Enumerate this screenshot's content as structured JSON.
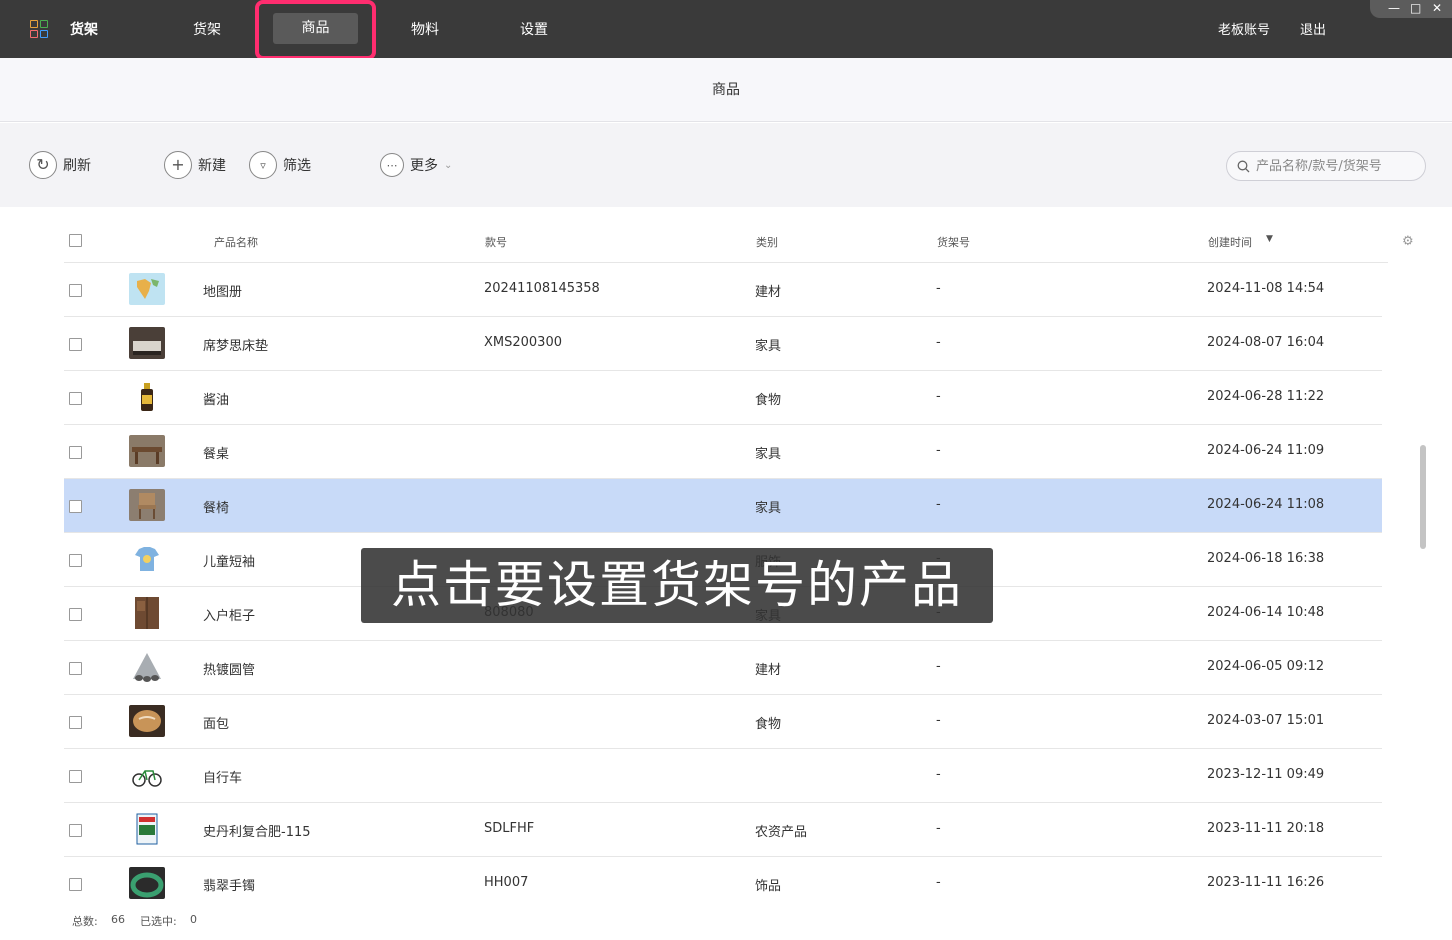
{
  "topbar": {
    "app_title": "货架",
    "nav": [
      "货架",
      "商品",
      "物料",
      "设置"
    ],
    "active_nav": "商品",
    "account": "老板账号",
    "logout": "退出",
    "window_controls": [
      "minimize-icon",
      "maximize-icon",
      "close-icon"
    ]
  },
  "header": {
    "title": "商品"
  },
  "toolbar": {
    "refresh": "刷新",
    "new": "新建",
    "filter": "筛选",
    "more": "更多",
    "search_placeholder": "产品名称/款号/货架号"
  },
  "table": {
    "columns": {
      "name": "产品名称",
      "code": "款号",
      "category": "类别",
      "shelf": "货架号",
      "created": "创建时间"
    },
    "sort_indicator": "▼",
    "rows": [
      {
        "name": "地图册",
        "code": "20241108145358",
        "category": "建材",
        "shelf": "-",
        "created": "2024-11-08 14:54",
        "thumb": "map"
      },
      {
        "name": "席梦思床垫",
        "code": "XMS200300",
        "category": "家具",
        "shelf": "-",
        "created": "2024-08-07 16:04",
        "thumb": "bed"
      },
      {
        "name": "酱油",
        "code": "",
        "category": "食物",
        "shelf": "-",
        "created": "2024-06-28 11:22",
        "thumb": "bottle"
      },
      {
        "name": "餐桌",
        "code": "",
        "category": "家具",
        "shelf": "-",
        "created": "2024-06-24 11:09",
        "thumb": "table"
      },
      {
        "name": "餐椅",
        "code": "",
        "category": "家具",
        "shelf": "-",
        "created": "2024-06-24 11:08",
        "thumb": "chair",
        "selected": true
      },
      {
        "name": "儿童短袖",
        "code": "",
        "category": "服饰",
        "shelf": "-",
        "created": "2024-06-18 16:38",
        "thumb": "shirt"
      },
      {
        "name": "入户柜子",
        "code": "808080",
        "category": "家具",
        "shelf": "-",
        "created": "2024-06-14 10:48",
        "thumb": "cabinet"
      },
      {
        "name": "热镀圆管",
        "code": "",
        "category": "建材",
        "shelf": "-",
        "created": "2024-06-05 09:12",
        "thumb": "pipe"
      },
      {
        "name": "面包",
        "code": "",
        "category": "食物",
        "shelf": "-",
        "created": "2024-03-07 15:01",
        "thumb": "bread"
      },
      {
        "name": "自行车",
        "code": "",
        "category": "",
        "shelf": "-",
        "created": "2023-12-11 09:49",
        "thumb": "bike"
      },
      {
        "name": "史丹利复合肥-115",
        "code": "SDLFHF",
        "category": "农资产品",
        "shelf": "-",
        "created": "2023-11-11 20:18",
        "thumb": "fertilizer"
      },
      {
        "name": "翡翠手镯",
        "code": "HH007",
        "category": "饰品",
        "shelf": "-",
        "created": "2023-11-11 16:26",
        "thumb": "bracelet"
      }
    ]
  },
  "footer": {
    "total_label": "总数:",
    "total": "66",
    "selected_label": "已选中:",
    "selected": "0"
  },
  "caption": "点击要设置货架号的产品",
  "colors": {
    "topbar": "#3a3a3a",
    "highlight": "#ff2d6f",
    "selected_row": "#c8daf8"
  }
}
